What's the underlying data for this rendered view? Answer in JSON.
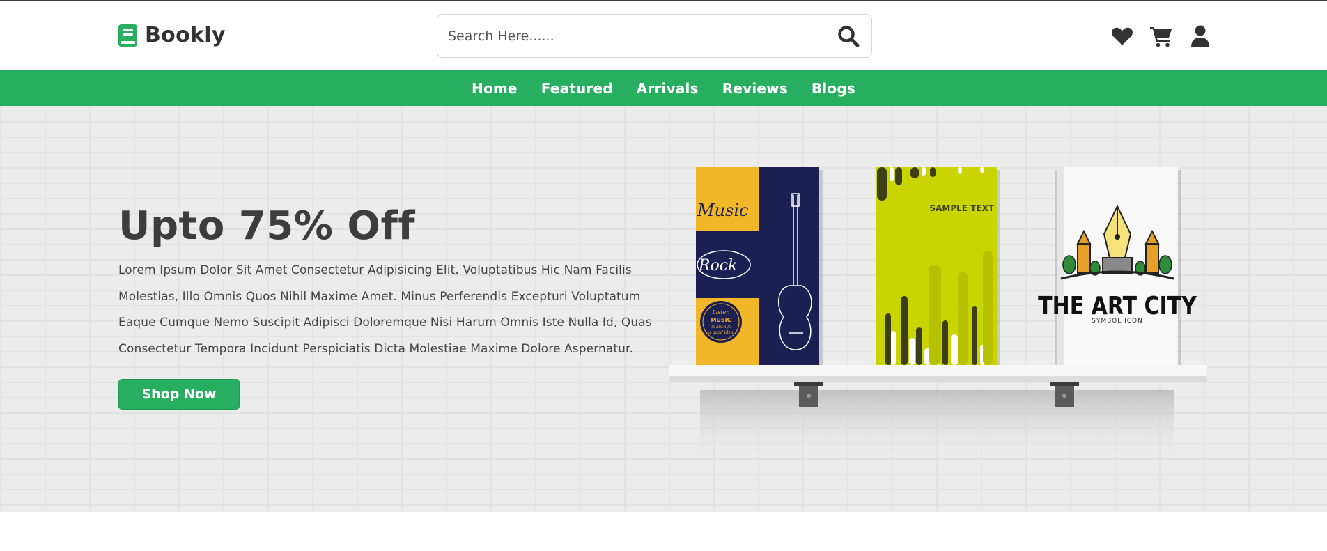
{
  "header": {
    "logo_text": "Bookly",
    "search": {
      "placeholder": "Search Here......"
    },
    "icons": [
      "search-icon",
      "heart-icon",
      "cart-icon",
      "user-icon"
    ]
  },
  "nav": {
    "items": [
      {
        "label": "Home"
      },
      {
        "label": "Featured"
      },
      {
        "label": "Arrivals"
      },
      {
        "label": "Reviews"
      },
      {
        "label": "Blogs"
      }
    ]
  },
  "hero": {
    "title": "Upto 75% Off",
    "description": "Lorem Ipsum Dolor Sit Amet Consectetur Adipisicing Elit. Voluptatibus Hic Nam Facilis Molestias, Illo Omnis Quos Nihil Maxime Amet. Minus Perferendis Excepturi Voluptatum Eaque Cumque Nemo Suscipit Adipisci Doloremque Nisi Harum Omnis Iste Nulla Id, Quas Consectetur Tempora Incidunt Perspiciatis Dicta Molestiae Maxime Dolore Aspernatur.",
    "cta_label": "Shop Now",
    "books": [
      {
        "cover_text": [
          "Music",
          "Rock",
          "Listen",
          "MUSIC",
          "is always",
          "a good idea"
        ]
      },
      {
        "cover_text": [
          "SAMPLE TEXT"
        ]
      },
      {
        "cover_text": [
          "THE ART CITY",
          "SYMBOL ICON"
        ]
      }
    ]
  },
  "colors": {
    "brand_green": "#27ae60",
    "text_dark": "#333333",
    "hero_bg": "#ececec"
  }
}
